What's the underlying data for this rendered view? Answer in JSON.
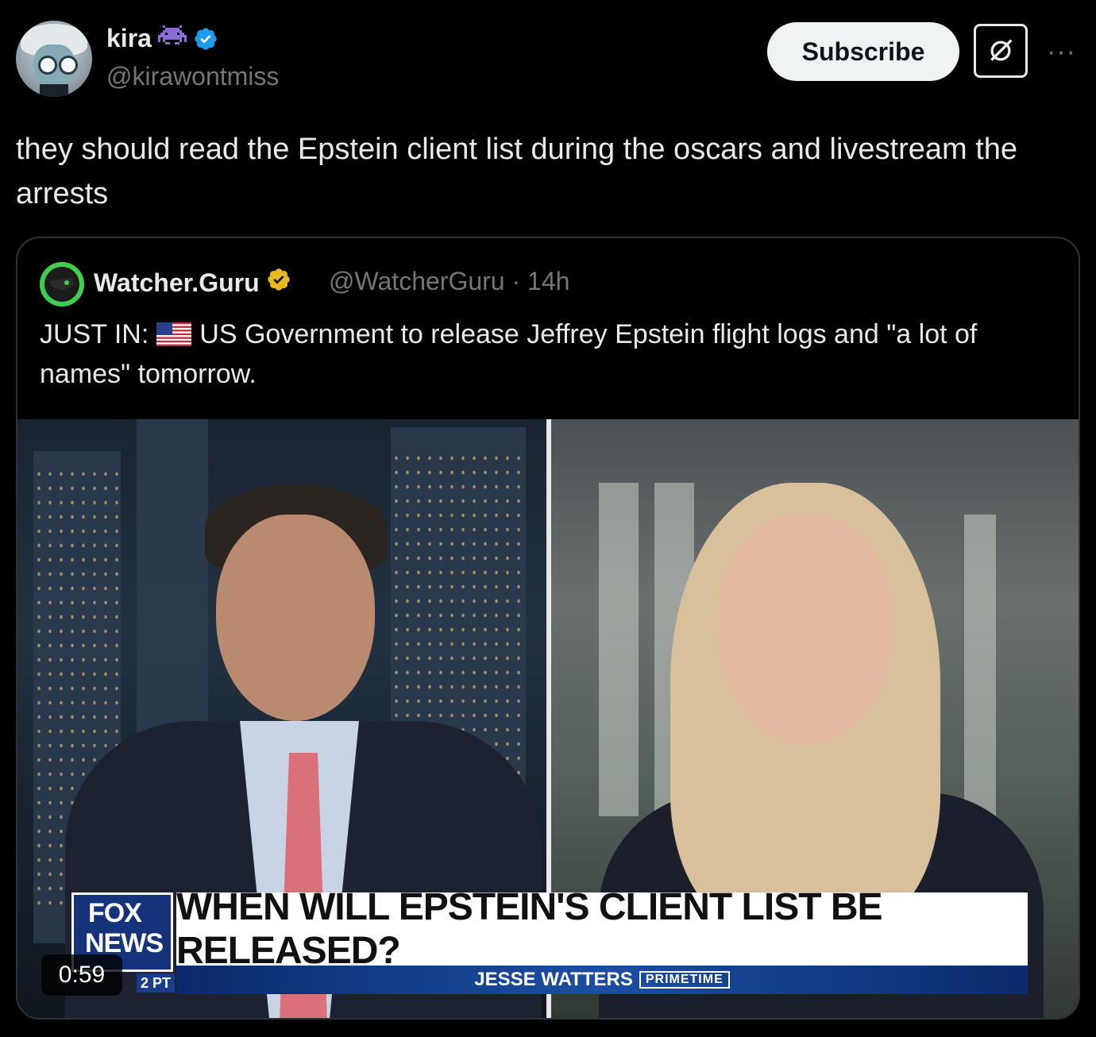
{
  "author": {
    "display_name": "kira",
    "handle": "@kirawontmiss",
    "icons": [
      "alien-monster-icon",
      "verified-badge-icon"
    ]
  },
  "actions": {
    "subscribe_label": "Subscribe",
    "grok_icon": "grok-icon",
    "more_icon": "more-icon",
    "more_label": "···"
  },
  "tweet": {
    "text": "they should read the Epstein client list during the oscars and livestream the arrests"
  },
  "quote": {
    "display_name": "Watcher.Guru",
    "handle_time": "@WatcherGuru · 14h",
    "text_prefix": "JUST IN:",
    "flag_icon": "us-flag-icon",
    "text_body": "US Government to release Jeffrey Epstein flight logs and \"a lot of names\" tomorrow."
  },
  "video": {
    "duration": "0:59",
    "logo_top": "FOX",
    "logo_bottom": "NEWS",
    "headline": "WHEN WILL EPSTEIN'S CLIENT LIST BE RELEASED?",
    "show_name": "JESSE WATTERS",
    "show_suffix": "PRIMETIME",
    "timezone": "2 PT"
  },
  "colors": {
    "background": "#000000",
    "text": "#e7e9ea",
    "muted": "#71767b",
    "verified_blue": "#1d9bf0",
    "verified_gold": "#e8b923",
    "fox_blue": "#14337a"
  }
}
